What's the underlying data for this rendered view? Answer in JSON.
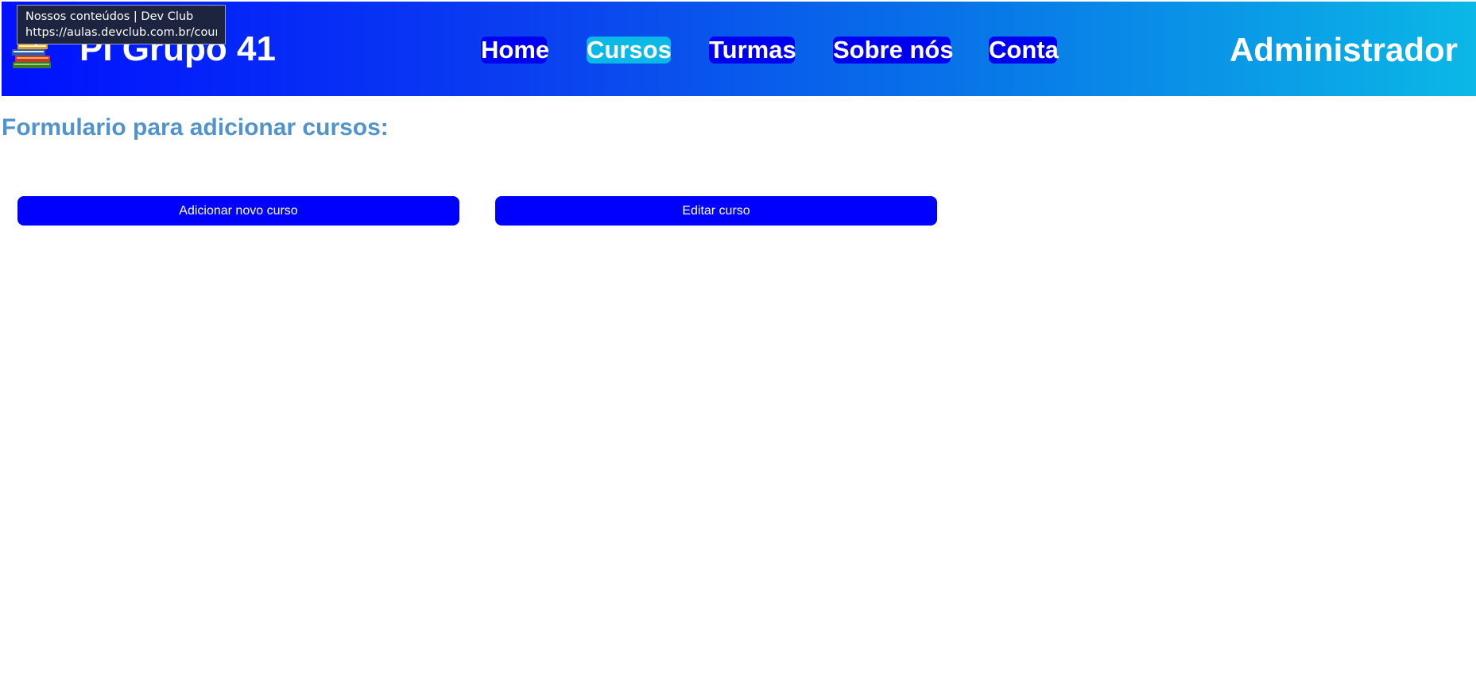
{
  "header": {
    "logo_icon": "books-stack-icon",
    "site_title": "PI Grupo 41",
    "nav": [
      {
        "label": "Home",
        "active": false
      },
      {
        "label": "Cursos",
        "active": true
      },
      {
        "label": "Turmas",
        "active": false
      },
      {
        "label": "Sobre nós",
        "active": false
      },
      {
        "label": "Conta",
        "active": false
      }
    ],
    "user_role": "Administrador"
  },
  "tooltip": {
    "title": "Nossos conteúdos | Dev Club",
    "url": "https://aulas.devclub.com.br/courses"
  },
  "main": {
    "heading": "Formulario para adicionar cursos:",
    "buttons": {
      "add_label": "Adicionar novo curso",
      "edit_label": "Editar curso"
    }
  },
  "colors": {
    "header_gradient_start": "#0011ff",
    "header_gradient_end": "#0bb8e6",
    "nav_bg": "#0000f0",
    "nav_active_bg": "#0bb8e6",
    "heading": "#5193cc",
    "button_bg": "#0000ff"
  }
}
